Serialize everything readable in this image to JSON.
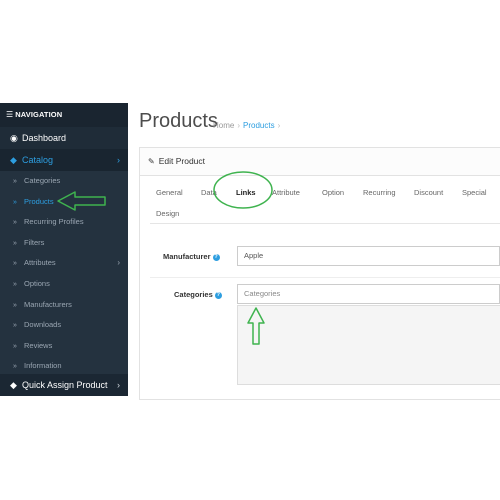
{
  "sidebar": {
    "header": "NAVIGATION",
    "dashboard": "Dashboard",
    "catalog": "Catalog",
    "items": [
      {
        "label": "Categories"
      },
      {
        "label": "Products"
      },
      {
        "label": "Recurring Profiles"
      },
      {
        "label": "Filters"
      },
      {
        "label": "Attributes"
      },
      {
        "label": "Options"
      },
      {
        "label": "Manufacturers"
      },
      {
        "label": "Downloads"
      },
      {
        "label": "Reviews"
      },
      {
        "label": "Information"
      }
    ],
    "quick_assign": "Quick Assign Product"
  },
  "header": {
    "title": "Products",
    "breadcrumb": [
      "Home",
      "Products"
    ]
  },
  "panel": {
    "heading": "Edit Product",
    "tabs": [
      "General",
      "Data",
      "Links",
      "Attribute",
      "Option",
      "Recurring",
      "Discount",
      "Special",
      "Design"
    ],
    "active_tab": "Links"
  },
  "form": {
    "manufacturer_label": "Manufacturer",
    "manufacturer_value": "Apple",
    "categories_label": "Categories",
    "categories_placeholder": "Categories"
  },
  "colors": {
    "sidebar_bg": "#1e2a36",
    "accent": "#2d9ee0",
    "annotation": "#3fb34f"
  }
}
